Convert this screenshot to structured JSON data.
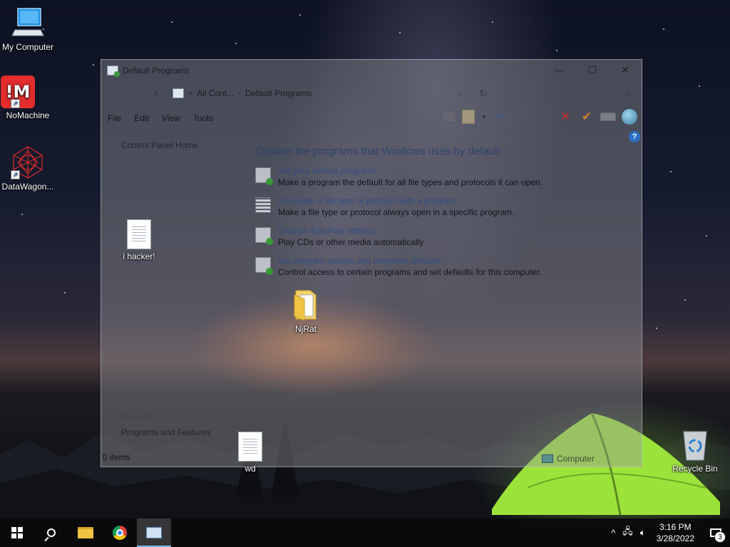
{
  "desktop": {
    "icons": [
      {
        "label": "My Computer",
        "icon": "monitor-icon"
      },
      {
        "label": "NoMachine",
        "icon": "nomachine-icon"
      },
      {
        "label": "DataWagon...",
        "icon": "datawagon-icon"
      },
      {
        "label": "i hacker!",
        "icon": "text-document-icon"
      },
      {
        "label": "NjRat",
        "icon": "folder-icon"
      },
      {
        "label": "wd",
        "icon": "text-document-icon"
      },
      {
        "label": "Recycle Bin",
        "icon": "recycle-bin-icon"
      }
    ],
    "nomachine_badge": "!M"
  },
  "window": {
    "title": "Default Programs",
    "controls": {
      "minimize": "—",
      "maximize": "☐",
      "close": "✕"
    },
    "address": {
      "ellipsis": "«",
      "crumbs": [
        "All Cont...",
        "Default Programs"
      ]
    },
    "menu": [
      "File",
      "Edit",
      "View",
      "Tools"
    ],
    "left_pane": {
      "home": "Control Panel Home",
      "see_also": "See also",
      "see_also_link": "Programs and Features"
    },
    "heading": "Choose the programs that Windows uses by default",
    "tasks": [
      {
        "title": "Set your default programs",
        "desc": "Make a program the default for all file types and protocols it can open."
      },
      {
        "title": "Associate a file type or protocol with a program",
        "desc": "Make a file type or protocol always open in a specific program."
      },
      {
        "title": "Change AutoPlay settings",
        "desc": "Play CDs or other media automatically"
      },
      {
        "title": "Set program access and computer defaults",
        "desc": "Control access to certain programs and set defaults for this computer."
      }
    ],
    "status": {
      "items": "0 items",
      "location": "Computer"
    },
    "help": "?"
  },
  "taskbar": {
    "time": "3:16 PM",
    "date": "3/28/2022",
    "notification_count": "3",
    "tray_caret": "^"
  },
  "colors": {
    "taskbar": "#0a0a0c",
    "accent": "#76b9ed",
    "tent": "#9be33a"
  }
}
